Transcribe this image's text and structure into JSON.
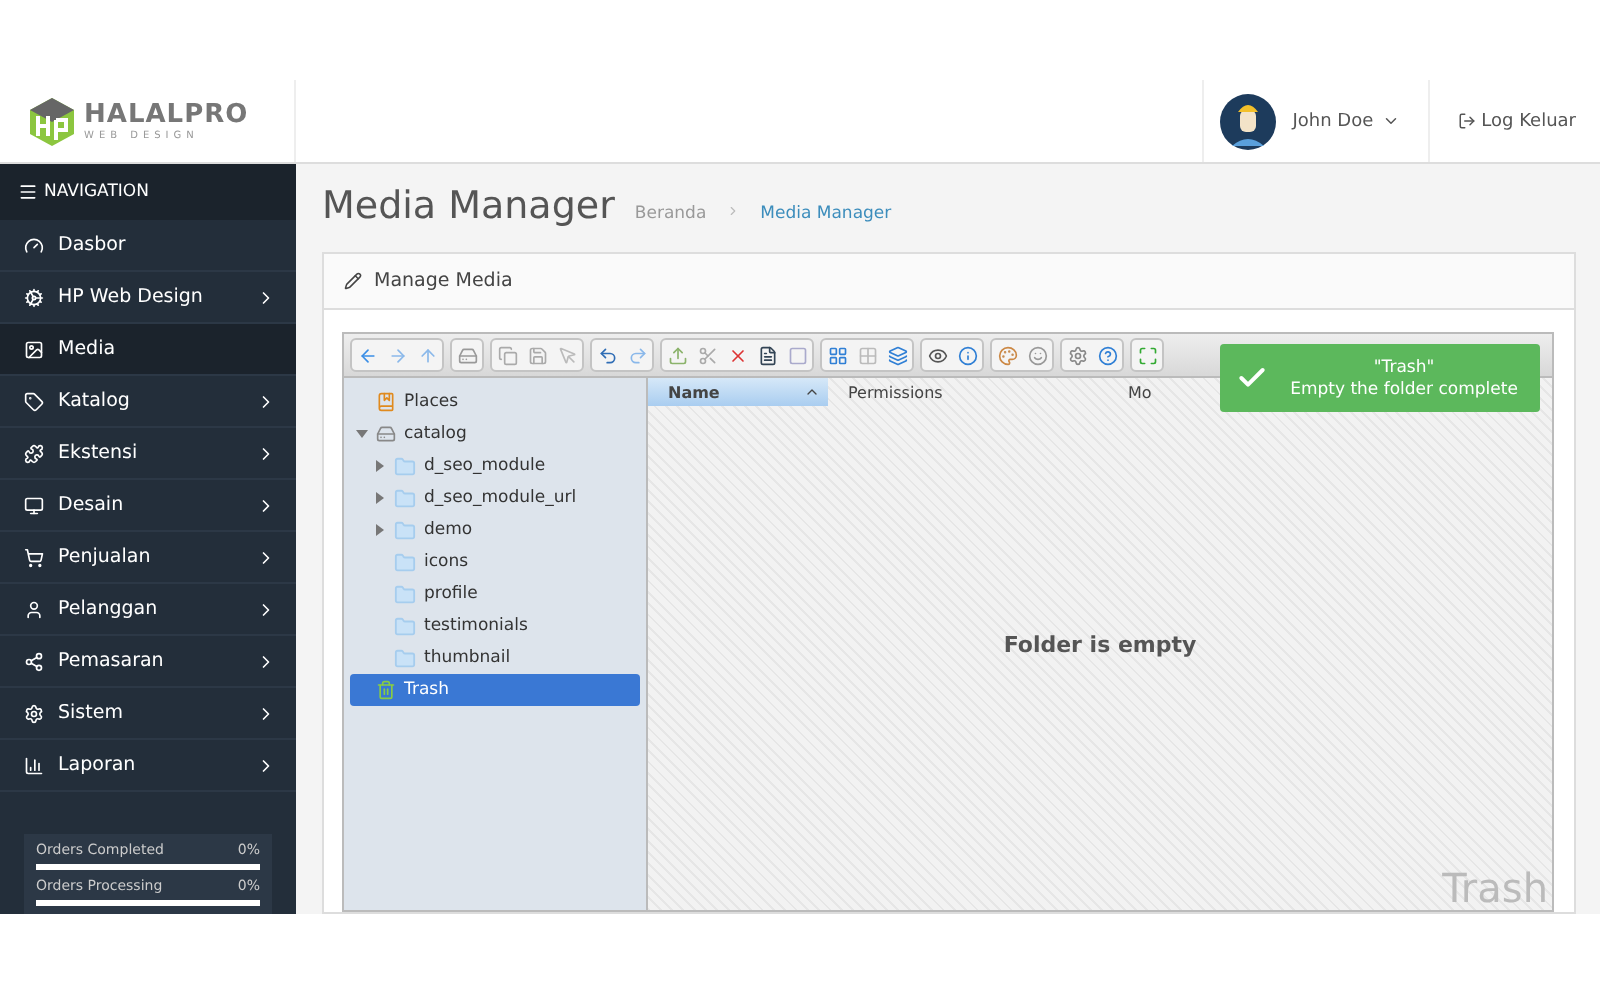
{
  "header": {
    "logo_main": "HALALPRO",
    "logo_sub": "WEB DESIGN",
    "user": "John Doe",
    "logout": "Log Keluar"
  },
  "sidebar": {
    "title": "NAVIGATION",
    "items": [
      {
        "label": "Dasbor",
        "kind": "dashboard",
        "has_children": false,
        "selected": false
      },
      {
        "label": "HP Web Design",
        "kind": "cogs",
        "has_children": true,
        "selected": false
      },
      {
        "label": "Media",
        "kind": "image",
        "has_children": false,
        "selected": true
      },
      {
        "label": "Katalog",
        "kind": "tag",
        "has_children": true,
        "selected": false
      },
      {
        "label": "Ekstensi",
        "kind": "puzzle",
        "has_children": true,
        "selected": false
      },
      {
        "label": "Desain",
        "kind": "monitor",
        "has_children": true,
        "selected": false
      },
      {
        "label": "Penjualan",
        "kind": "cart",
        "has_children": true,
        "selected": false
      },
      {
        "label": "Pelanggan",
        "kind": "user",
        "has_children": true,
        "selected": false
      },
      {
        "label": "Pemasaran",
        "kind": "share",
        "has_children": true,
        "selected": false
      },
      {
        "label": "Sistem",
        "kind": "cog",
        "has_children": true,
        "selected": false
      },
      {
        "label": "Laporan",
        "kind": "chart",
        "has_children": true,
        "selected": false
      }
    ],
    "stats": [
      {
        "label": "Orders Completed",
        "reading": "0%",
        "level": 0
      },
      {
        "label": "Orders Processing",
        "reading": "0%",
        "level": 0
      }
    ]
  },
  "page": {
    "title": "Media Manager",
    "breadcrumb": [
      {
        "label": "Beranda",
        "selected": false
      },
      {
        "label": "Media Manager",
        "selected": true
      }
    ],
    "panel_title": "Manage Media"
  },
  "filemanager": {
    "tree": [
      {
        "label": "Places",
        "kind": "places",
        "selected": false
      },
      {
        "label": "catalog",
        "kind": "drive",
        "selected": false,
        "expanded": true,
        "children": [
          {
            "label": "d_seo_module",
            "kind": "folder",
            "selected": false,
            "expanded": false
          },
          {
            "label": "d_seo_module_url",
            "kind": "folder",
            "selected": false,
            "expanded": false
          },
          {
            "label": "demo",
            "kind": "folder",
            "selected": false,
            "expanded": false
          },
          {
            "label": "icons",
            "kind": "folder",
            "selected": false
          },
          {
            "label": "profile",
            "kind": "folder",
            "selected": false
          },
          {
            "label": "testimonials",
            "kind": "folder",
            "selected": false
          },
          {
            "label": "thumbnail",
            "kind": "folder",
            "selected": false
          }
        ]
      },
      {
        "label": "Trash",
        "kind": "trash",
        "selected": true
      }
    ],
    "columns": [
      {
        "label": "Name",
        "sorted": true
      },
      {
        "label": "Permissions",
        "sorted": false
      },
      {
        "label": "Mo",
        "sorted": false
      }
    ],
    "empty_message": "Folder is empty",
    "watermark": "Trash",
    "toast": {
      "title": "\"Trash\"",
      "message": "Empty the folder complete"
    }
  }
}
